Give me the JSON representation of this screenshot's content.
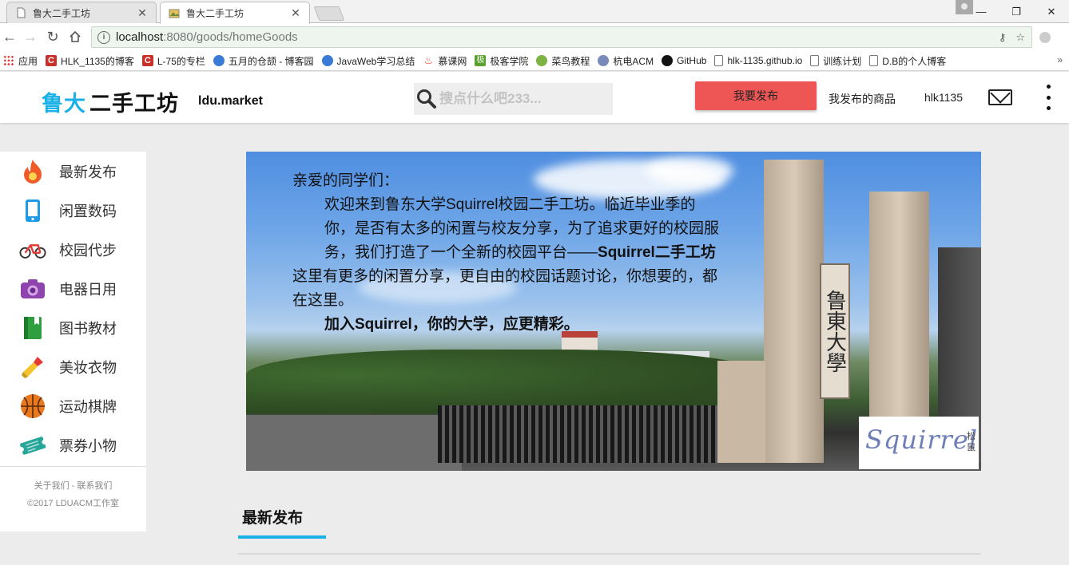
{
  "browser": {
    "tabs": [
      {
        "title": "鲁大二手工坊",
        "active": false
      },
      {
        "title": "鲁大二手工坊",
        "active": true
      }
    ],
    "url": {
      "host": "localhost",
      "rest": ":8080/goods/homeGoods"
    },
    "bookmarks": [
      {
        "label": "应用",
        "icon": "apps-grid-icon",
        "color": "#c44"
      },
      {
        "label": "HLK_1135的博客",
        "icon": "csdn-icon",
        "color": "#c9302c"
      },
      {
        "label": "L-75的专栏",
        "icon": "csdn-icon",
        "color": "#c9302c"
      },
      {
        "label": "五月的仓颉 - 博客园",
        "icon": "cnblogs-icon",
        "color": "#3a7bd5"
      },
      {
        "label": "JavaWeb学习总结",
        "icon": "cnblogs-icon",
        "color": "#3a7bd5"
      },
      {
        "label": "慕课网",
        "icon": "imooc-icon",
        "color": "#e94b35"
      },
      {
        "label": "极客学院",
        "icon": "jikexueyuan-icon",
        "color": "#5aa02c"
      },
      {
        "label": "菜鸟教程",
        "icon": "runoob-icon",
        "color": "#7cb342"
      },
      {
        "label": "杭电ACM",
        "icon": "hdu-icon",
        "color": "#7a8ab8"
      },
      {
        "label": "GitHub",
        "icon": "github-icon",
        "color": "#111"
      },
      {
        "label": "hlk-1135.github.io",
        "icon": "page-icon",
        "color": "#888"
      },
      {
        "label": "训练计划",
        "icon": "page-icon",
        "color": "#888"
      },
      {
        "label": "D.B的个人博客",
        "icon": "page-icon",
        "color": "#888"
      }
    ]
  },
  "header": {
    "logo_part1": "鲁大",
    "logo_part2": "二手工坊",
    "domain": "ldu.market",
    "search_placeholder": "搜点什么吧233...",
    "publish_label": "我要发布",
    "my_goods_label": "我发布的商品",
    "username": "hlk1135",
    "accent": "#1ab0e8",
    "publish_color": "#ee5656"
  },
  "sidebar": {
    "categories": [
      {
        "label": "最新发布",
        "icon": "fire-icon"
      },
      {
        "label": "闲置数码",
        "icon": "phone-icon"
      },
      {
        "label": "校园代步",
        "icon": "bicycle-icon"
      },
      {
        "label": "电器日用",
        "icon": "camera-icon"
      },
      {
        "label": "图书教材",
        "icon": "book-icon"
      },
      {
        "label": "美妆衣物",
        "icon": "lipstick-icon"
      },
      {
        "label": "运动棋牌",
        "icon": "basketball-icon"
      },
      {
        "label": "票券小物",
        "icon": "ticket-icon"
      }
    ],
    "footer_links": "关于我们 - 联系我们",
    "copyright": "©2017 LDUACM工作室"
  },
  "banner": {
    "greeting": "亲爱的同学们：",
    "para1": "欢迎来到鲁东大学Squirrel校园二手工坊。临近毕业季的你，是否有太多的闲置与校友分享，为了追求更好的校园服务，我们打造了一个全新的校园平台——",
    "para1_bold": "Squirrel二手工坊",
    "para2": "这里有更多的闲置分享，更自由的校园话题讨论，你想要的，都在这里。",
    "slogan": "加入Squirrel，你的大学，应更精彩。",
    "stamp_text": "Squirrel",
    "stamp_cn": "松鼠",
    "plaque_text": "鲁東大學"
  },
  "section": {
    "title": "最新发布"
  }
}
